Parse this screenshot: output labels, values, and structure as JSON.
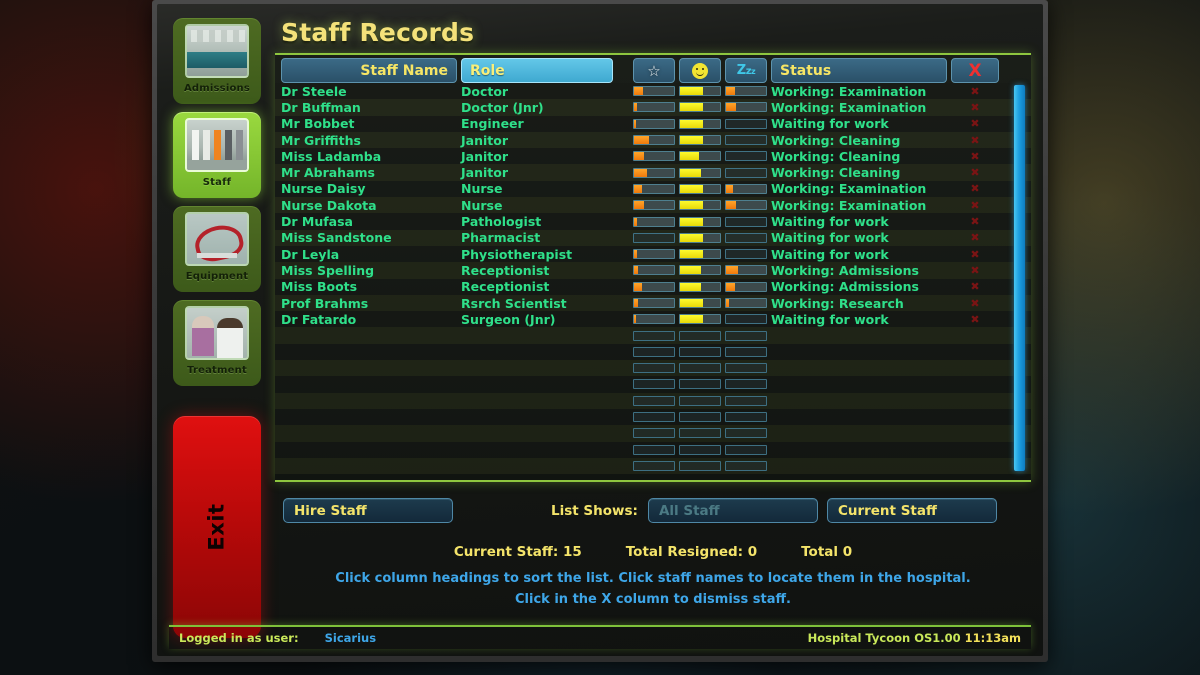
{
  "window": {
    "title": "Staff Records"
  },
  "sidebar": {
    "items": [
      {
        "label": "Admissions",
        "thumb": "th-admissions",
        "selected": false
      },
      {
        "label": "Staff",
        "thumb": "th-staff",
        "selected": true
      },
      {
        "label": "Equipment",
        "thumb": "th-equipment",
        "selected": false
      },
      {
        "label": "Treatment",
        "thumb": "th-treatment",
        "selected": false
      }
    ],
    "exit_label": "Exit"
  },
  "table": {
    "headers": {
      "name": "Staff Name",
      "role": "Role",
      "skill_icon": "star-icon",
      "happiness_icon": "smiley-icon",
      "tiredness_icon": "zzz-icon",
      "zzz_text": "Zzz",
      "status": "Status",
      "dismiss": "X"
    },
    "active_sort_column": "Role",
    "rows": [
      {
        "name": "Dr Steele",
        "role": "Doctor",
        "skill": 22,
        "happiness": 58,
        "tiredness": 22,
        "status": "Working: Examination"
      },
      {
        "name": "Dr Buffman",
        "role": "Doctor (Jnr)",
        "skill": 8,
        "happiness": 58,
        "tiredness": 26,
        "status": "Working: Examination"
      },
      {
        "name": "Mr Bobbet",
        "role": "Engineer",
        "skill": 4,
        "happiness": 58,
        "tiredness": 0,
        "status": "Waiting for work"
      },
      {
        "name": "Mr Griffiths",
        "role": "Janitor",
        "skill": 38,
        "happiness": 58,
        "tiredness": 0,
        "status": "Working: Cleaning"
      },
      {
        "name": "Miss Ladamba",
        "role": "Janitor",
        "skill": 26,
        "happiness": 48,
        "tiredness": 0,
        "status": "Working: Cleaning"
      },
      {
        "name": "Mr Abrahams",
        "role": "Janitor",
        "skill": 32,
        "happiness": 53,
        "tiredness": 0,
        "status": "Working: Cleaning"
      },
      {
        "name": "Nurse Daisy",
        "role": "Nurse",
        "skill": 20,
        "happiness": 58,
        "tiredness": 18,
        "status": "Working: Examination"
      },
      {
        "name": "Nurse Dakota",
        "role": "Nurse",
        "skill": 26,
        "happiness": 58,
        "tiredness": 26,
        "status": "Working: Examination"
      },
      {
        "name": "Dr Mufasa",
        "role": "Pathologist",
        "skill": 8,
        "happiness": 58,
        "tiredness": 0,
        "status": "Waiting for work"
      },
      {
        "name": "Miss Sandstone",
        "role": "Pharmacist",
        "skill": 0,
        "happiness": 58,
        "tiredness": 0,
        "status": "Waiting for work"
      },
      {
        "name": "Dr Leyla",
        "role": "Physiotherapist",
        "skill": 7,
        "happiness": 58,
        "tiredness": 0,
        "status": "Waiting for work"
      },
      {
        "name": "Miss Spelling",
        "role": "Receptionist",
        "skill": 9,
        "happiness": 53,
        "tiredness": 30,
        "status": "Working: Admissions"
      },
      {
        "name": "Miss Boots",
        "role": "Receptionist",
        "skill": 20,
        "happiness": 53,
        "tiredness": 22,
        "status": "Working: Admissions"
      },
      {
        "name": "Prof Brahms",
        "role": "Rsrch Scientist",
        "skill": 9,
        "happiness": 58,
        "tiredness": 7,
        "status": "Working: Research"
      },
      {
        "name": "Dr Fatardo",
        "role": "Surgeon (Jnr)",
        "skill": 4,
        "happiness": 58,
        "tiredness": 0,
        "status": "Waiting for work"
      }
    ],
    "empty_row_count": 9
  },
  "controls": {
    "hire_staff": "Hire Staff",
    "list_shows_label": "List Shows:",
    "list_filter_value": "All Staff",
    "list_scope_value": "Current Staff"
  },
  "counts": {
    "current_staff": "Current Staff: 15",
    "total_resigned": "Total Resigned: 0",
    "total": "Total 0"
  },
  "hints": {
    "line1": "Click column headings to sort the list. Click staff names to locate them in the hospital.",
    "line2": "Click in the X column to dismiss staff."
  },
  "statusbar": {
    "logged_in_label": "Logged in as user:",
    "username": "Sicarius",
    "os_label": "Hospital Tycoon OS1.00",
    "time": "11:13am"
  },
  "colors": {
    "accent_green": "#8ec63f",
    "title_yellow": "#f4e27a",
    "row_text_green": "#2fe08a",
    "header_blue": "#3b6a86",
    "active_header": "#63c7e8",
    "scrollbar_blue": "#1d9fe0",
    "hint_blue": "#3ea6e8",
    "bar_skill_orange": "#f08a1a",
    "bar_happy_yellow": "#f5ef15",
    "exit_red": "#c00c0c"
  }
}
